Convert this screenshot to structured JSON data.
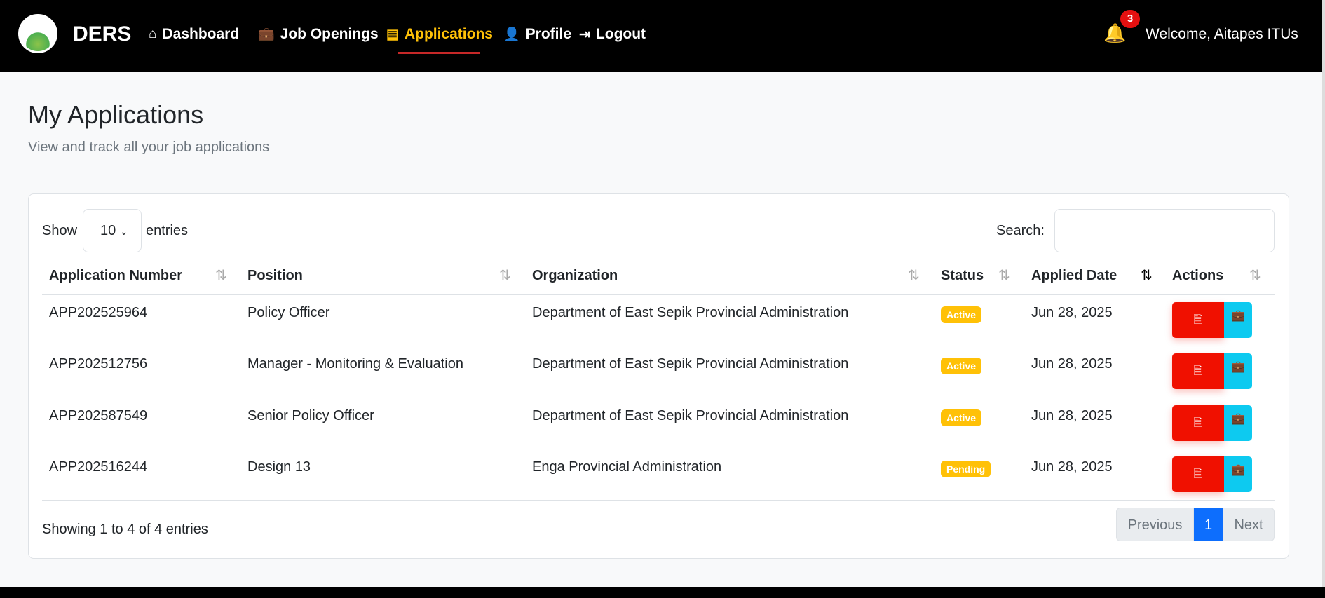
{
  "nav": {
    "brand": "DERS",
    "items": [
      {
        "label": "Dashboard",
        "icon": "⌂"
      },
      {
        "label": "Job Openings",
        "icon": "💼"
      },
      {
        "label": "Applications",
        "icon": "▤"
      },
      {
        "label": "Profile",
        "icon": "👤"
      },
      {
        "label": "Logout",
        "icon": "⇥"
      }
    ],
    "notifications": "3",
    "welcome": "Welcome, Aitapes ITUs"
  },
  "page": {
    "title": "My Applications",
    "subtitle": "View and track all your job applications"
  },
  "table": {
    "show": "Show",
    "entries_value": "10",
    "entries": "entries",
    "search_label": "Search:",
    "search_value": "",
    "columns": [
      "Application Number",
      "Position",
      "Organization",
      "Status",
      "Applied Date",
      "Actions"
    ],
    "rows": [
      {
        "number": "APP202525964",
        "position": "Policy Officer",
        "organization": "Department of East Sepik Provincial Administration",
        "status": "Active",
        "date": "Jun 28, 2025"
      },
      {
        "number": "APP202512756",
        "position": "Manager - Monitoring & Evaluation",
        "organization": "Department of East Sepik Provincial Administration",
        "status": "Active",
        "date": "Jun 28, 2025"
      },
      {
        "number": "APP202587549",
        "position": "Senior Policy Officer",
        "organization": "Department of East Sepik Provincial Administration",
        "status": "Active",
        "date": "Jun 28, 2025"
      },
      {
        "number": "APP202516244",
        "position": "Design 13",
        "organization": "Enga Provincial Administration",
        "status": "Pending",
        "date": "Jun 28, 2025"
      }
    ],
    "info": "Showing 1 to 4 of 4 entries",
    "prev": "Previous",
    "page": "1",
    "next": "Next"
  }
}
